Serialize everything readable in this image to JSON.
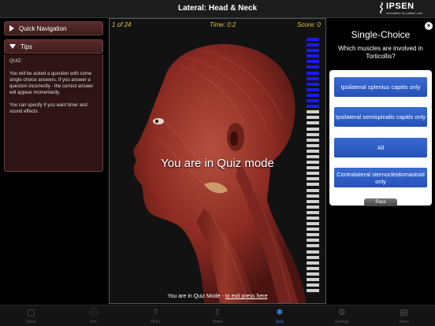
{
  "titlebar": {
    "title": "Lateral: Head & Neck"
  },
  "logo": {
    "brand": "IPSEN",
    "tagline": "Innovation for patient care"
  },
  "left": {
    "quick_nav_label": "Quick Navigation",
    "tips_label": "Tips",
    "tips_paragraphs": [
      "QUIZ:",
      "You will be asked a question with some single choice answers. If you answer a question incorrectly - the correct answer will appear momentarily.",
      "You can specify if you want timer and sound effects."
    ]
  },
  "viewer": {
    "counter": "1 of 24",
    "timer": "Time: 0:2",
    "score": "Score: 0",
    "overlay_text": "You are in Quiz mode",
    "exit_prefix": "You are in Quiz Mode - ",
    "exit_link": "to exit press here",
    "progress": {
      "total": 46,
      "remaining_blue": 13,
      "blue_color": "#1a1aff",
      "grey_color": "#cfcfcf"
    }
  },
  "quiz": {
    "title": "Single-Choice",
    "question": "Which muscles are involved in Torticollis?",
    "answers": [
      "Ipsilateral splenius capitis only",
      "Ipsilateral semispinalis capitis only",
      "All",
      "Contralateral sternocleidomastoid only"
    ],
    "pass_label": "Pass",
    "close_glyph": "×"
  },
  "toolbar": {
    "items": [
      {
        "label": "Views",
        "icon": "views-icon",
        "glyph": "▢"
      },
      {
        "label": "Info",
        "icon": "info-icon",
        "glyph": "ⓘ"
      },
      {
        "label": "Hints",
        "icon": "help-icon",
        "glyph": "?"
      },
      {
        "label": "Share",
        "icon": "share-icon",
        "glyph": "⇧"
      },
      {
        "label": "Quiz",
        "icon": "puzzle-icon",
        "glyph": "✱"
      },
      {
        "label": "Settings",
        "icon": "gear-icon",
        "glyph": "⚙"
      },
      {
        "label": "Index",
        "icon": "index-icon",
        "glyph": "▤"
      }
    ],
    "active_index": 4
  }
}
